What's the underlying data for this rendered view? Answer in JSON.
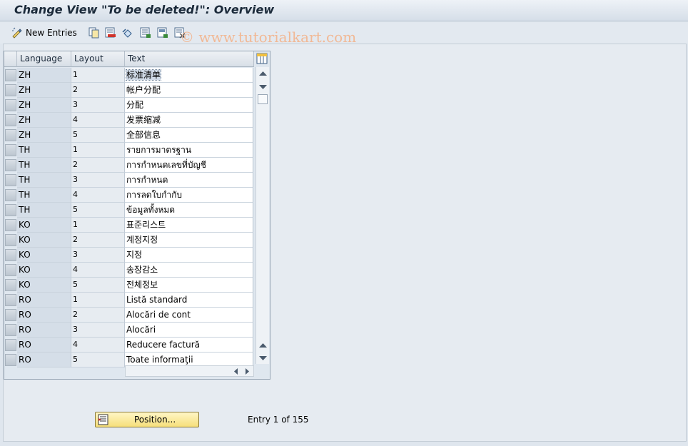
{
  "title": "Change View \"To be deleted!\": Overview",
  "toolbar": {
    "new_entries_label": "New Entries",
    "icons": [
      "new-entries-icon",
      "copy-icon",
      "delete-icon",
      "undo-icon",
      "select-all-icon",
      "select-block-icon",
      "deselect-all-icon"
    ]
  },
  "watermark": "© www.tutorialkart.com",
  "table": {
    "columns": [
      "Language",
      "Layout",
      "Text"
    ],
    "rows": [
      {
        "lang": "ZH",
        "layout": "1",
        "text": "标准清单"
      },
      {
        "lang": "ZH",
        "layout": "2",
        "text": "帐户分配"
      },
      {
        "lang": "ZH",
        "layout": "3",
        "text": "分配"
      },
      {
        "lang": "ZH",
        "layout": "4",
        "text": "发票缩减"
      },
      {
        "lang": "ZH",
        "layout": "5",
        "text": "全部信息"
      },
      {
        "lang": "TH",
        "layout": "1",
        "text": "รายการมาตรฐาน"
      },
      {
        "lang": "TH",
        "layout": "2",
        "text": "การกำหนดเลขที่บัญชี"
      },
      {
        "lang": "TH",
        "layout": "3",
        "text": "การกำหนด"
      },
      {
        "lang": "TH",
        "layout": "4",
        "text": "การลดใบกำกับ"
      },
      {
        "lang": "TH",
        "layout": "5",
        "text": "ข้อมูลทั้งหมด"
      },
      {
        "lang": "KO",
        "layout": "1",
        "text": "표준리스트"
      },
      {
        "lang": "KO",
        "layout": "2",
        "text": "계정지정"
      },
      {
        "lang": "KO",
        "layout": "3",
        "text": "지정"
      },
      {
        "lang": "KO",
        "layout": "4",
        "text": "송장감소"
      },
      {
        "lang": "KO",
        "layout": "5",
        "text": "전체정보"
      },
      {
        "lang": "RO",
        "layout": "1",
        "text": "Listă standard"
      },
      {
        "lang": "RO",
        "layout": "2",
        "text": "Alocări de cont"
      },
      {
        "lang": "RO",
        "layout": "3",
        "text": "Alocări"
      },
      {
        "lang": "RO",
        "layout": "4",
        "text": "Reducere factură"
      },
      {
        "lang": "RO",
        "layout": "5",
        "text": "Toate informaţii"
      }
    ]
  },
  "position_button_label": "Position...",
  "entry_info": "Entry 1 of 155"
}
